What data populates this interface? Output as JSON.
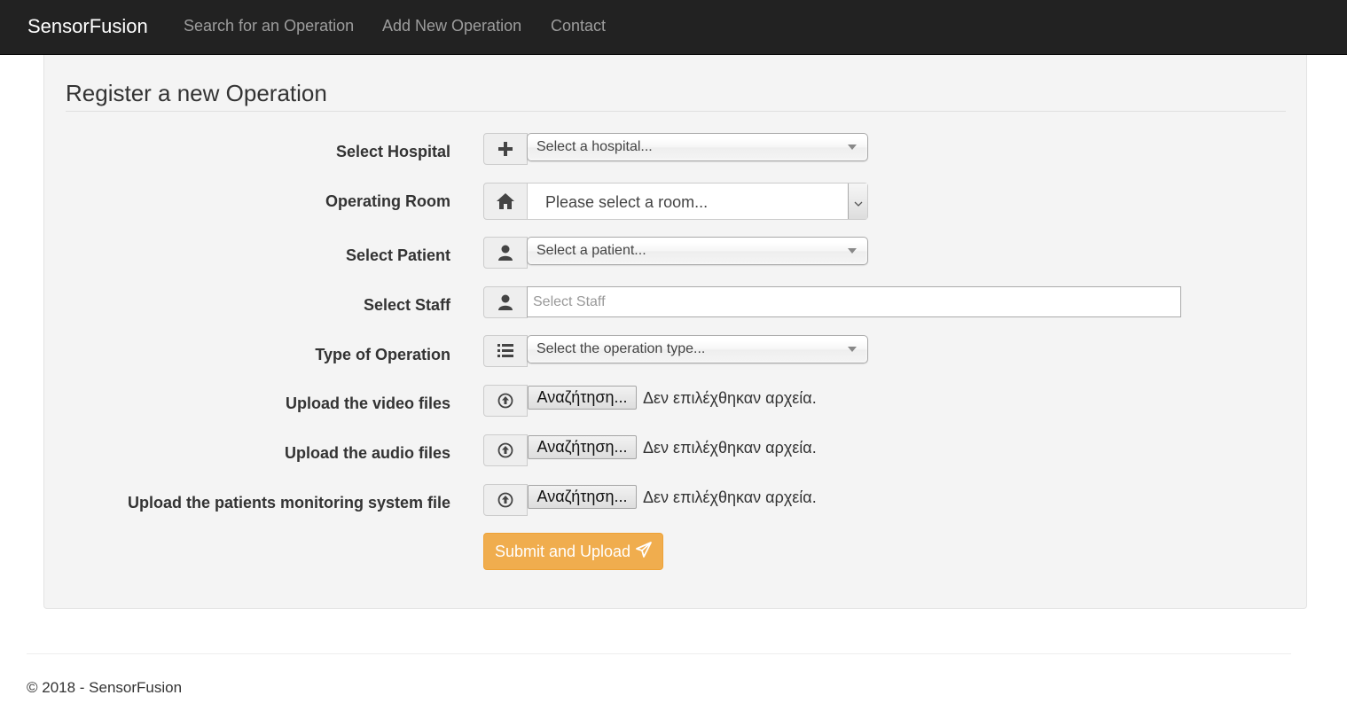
{
  "navbar": {
    "brand": "SensorFusion",
    "links": [
      "Search for an Operation",
      "Add New Operation",
      "Contact"
    ]
  },
  "form": {
    "legend": "Register a new Operation",
    "hospital": {
      "label": "Select Hospital",
      "placeholder": "Select a hospital...",
      "icon": "plus-icon"
    },
    "room": {
      "label": "Operating Room",
      "value": "Please select a room...",
      "icon": "home-icon"
    },
    "patient": {
      "label": "Select Patient",
      "placeholder": "Select a patient...",
      "icon": "user-icon"
    },
    "staff": {
      "label": "Select Staff",
      "placeholder": "Select Staff",
      "icon": "user-icon"
    },
    "operation_type": {
      "label": "Type of Operation",
      "placeholder": "Select the operation type...",
      "icon": "list-icon"
    },
    "uploads": [
      {
        "label": "Upload the video files",
        "button": "Αναζήτηση...",
        "status": "Δεν επιλέχθηκαν αρχεία.",
        "icon": "upload-circle-icon"
      },
      {
        "label": "Upload the audio files",
        "button": "Αναζήτηση...",
        "status": "Δεν επιλέχθηκαν αρχεία.",
        "icon": "upload-circle-icon"
      },
      {
        "label": "Upload the patients monitoring system file",
        "button": "Αναζήτηση...",
        "status": "Δεν επιλέχθηκαν αρχεία.",
        "icon": "upload-circle-icon"
      }
    ],
    "submit_label": "Submit and Upload",
    "submit_icon": "send-icon"
  },
  "footer": {
    "text": "© 2018 - SensorFusion"
  },
  "colors": {
    "navbar": "#222222",
    "accent": "#f0ad4e",
    "panel": "#f4f4f4"
  }
}
